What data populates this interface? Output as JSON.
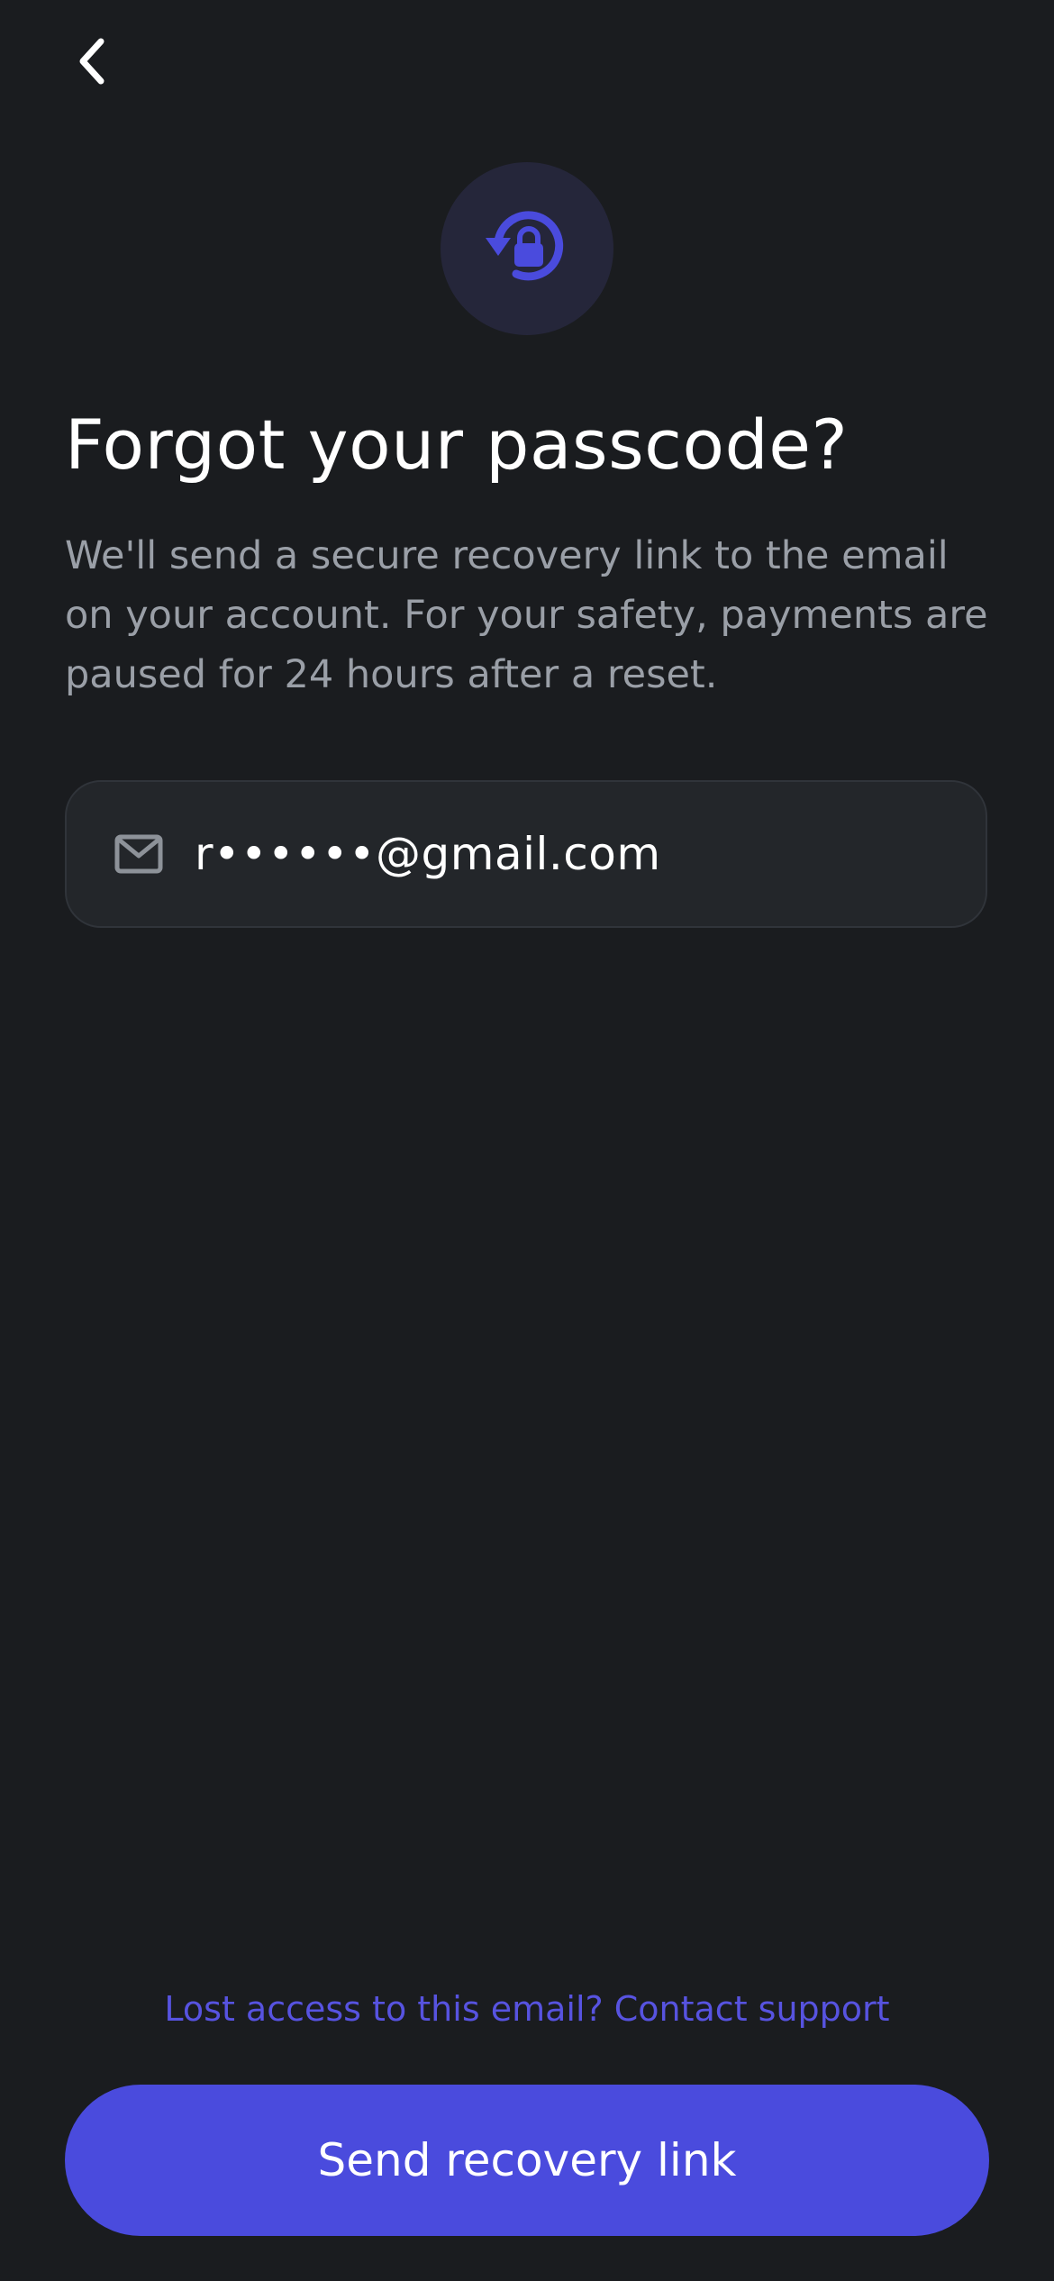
{
  "header": {
    "back_icon": "chevron-left-icon"
  },
  "hero": {
    "icon": "lock-reset-icon",
    "accent_color": "#4a4bdd",
    "circle_color": "#25263a"
  },
  "title": "Forgot your passcode?",
  "description": "We'll send a secure recovery link to the email on your account. For your safety, payments are paused for 24 hours after a reset.",
  "email_field": {
    "icon": "mail-icon",
    "value": "r••••••@gmail.com"
  },
  "support_link": "Lost access to this email? Contact support",
  "primary_button": {
    "label": "Send recovery link",
    "color": "#4a4bdd"
  }
}
